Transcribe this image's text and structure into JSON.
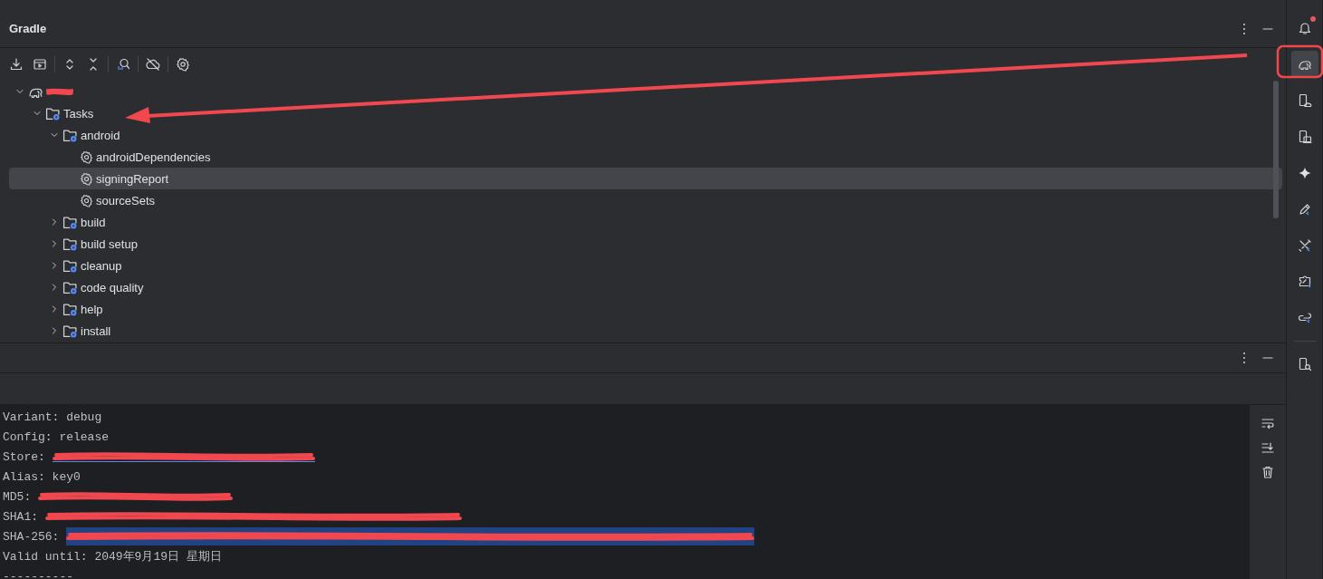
{
  "panel": {
    "title": "Gradle"
  },
  "tree": [
    {
      "kind": "project",
      "redacted": true,
      "expanded": true,
      "selected": false,
      "children": [
        {
          "label": "Tasks",
          "kind": "folder",
          "expanded": true,
          "selected": false,
          "children": [
            {
              "label": "android",
              "kind": "folder",
              "expanded": true,
              "selected": false,
              "children": [
                {
                  "label": "androidDependencies",
                  "kind": "task",
                  "selected": false
                },
                {
                  "label": "signingReport",
                  "kind": "task",
                  "selected": true
                },
                {
                  "label": "sourceSets",
                  "kind": "task",
                  "selected": false
                }
              ]
            },
            {
              "label": "build",
              "kind": "folder",
              "expanded": false,
              "selected": false
            },
            {
              "label": "build setup",
              "kind": "folder",
              "expanded": false,
              "selected": false
            },
            {
              "label": "cleanup",
              "kind": "folder",
              "expanded": false,
              "selected": false
            },
            {
              "label": "code quality",
              "kind": "folder",
              "expanded": false,
              "selected": false
            },
            {
              "label": "help",
              "kind": "folder",
              "expanded": false,
              "selected": false
            },
            {
              "label": "install",
              "kind": "folder",
              "expanded": false,
              "selected": false
            }
          ]
        }
      ]
    }
  ],
  "console": [
    {
      "text": "Variant: debug",
      "redacted": false,
      "selected": false
    },
    {
      "text": "Config: release",
      "redacted": false,
      "selected": false
    },
    {
      "text": "Store:",
      "kind": "link",
      "redacted": true,
      "selected": false
    },
    {
      "text": "Alias: key0",
      "redacted": false,
      "selected": false
    },
    {
      "text": "MD5:",
      "redacted": true,
      "selected": false
    },
    {
      "text": "SHA1:",
      "redacted": true,
      "selected": false
    },
    {
      "text": "SHA-256:",
      "redacted": true,
      "selected": true
    },
    {
      "text": "Valid until: 2049年9月19日 星期日",
      "redacted": false,
      "selected": false
    },
    {
      "text": "----------",
      "redacted": false,
      "selected": false
    }
  ],
  "sidebar": {
    "notification": true,
    "items": [
      {
        "selected": true
      },
      {
        "selected": false
      },
      {
        "selected": false
      },
      {
        "selected": false
      },
      {
        "selected": false
      },
      {
        "selected": false
      },
      {
        "selected": false
      },
      {
        "selected": false
      },
      {
        "selected": false
      }
    ]
  }
}
